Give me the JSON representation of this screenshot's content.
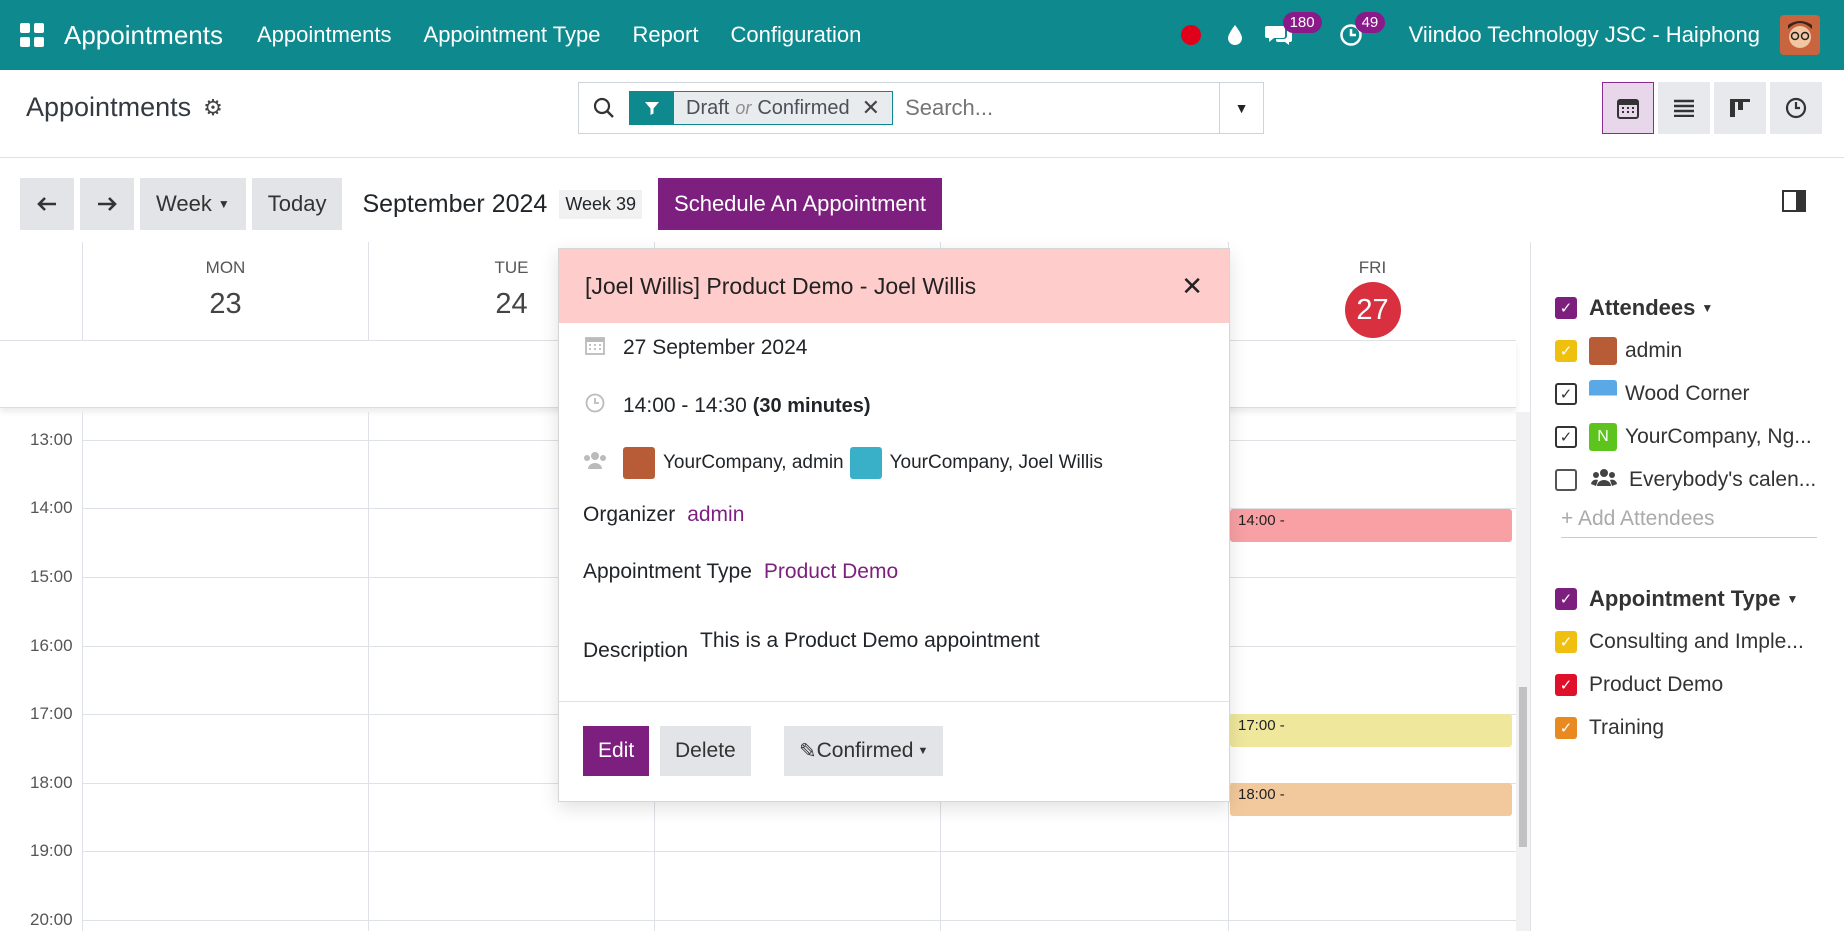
{
  "topbar": {
    "brand": "Appointments",
    "menu": [
      "Appointments",
      "Appointment Type",
      "Report",
      "Configuration"
    ],
    "chat_badge": "180",
    "activity_badge": "49",
    "company": "Viindoo Technology JSC - Haiphong"
  },
  "control_panel": {
    "title": "Appointments",
    "facet": {
      "value1": "Draft",
      "or": "or",
      "value2": "Confirmed"
    },
    "search_placeholder": "Search..."
  },
  "calendar_toolbar": {
    "scale": "Week",
    "today": "Today",
    "month": "September 2024",
    "week": "Week 39",
    "schedule": "Schedule An Appointment"
  },
  "days": [
    {
      "dow": "MON",
      "num": "23"
    },
    {
      "dow": "TUE",
      "num": "24"
    },
    {
      "dow": "FRI",
      "num": "27"
    }
  ],
  "hours": [
    "13:00",
    "14:00",
    "15:00",
    "16:00",
    "17:00",
    "18:00",
    "19:00",
    "20:00"
  ],
  "events": [
    {
      "time": "14:00 -",
      "color": "#f8a0a4"
    },
    {
      "time": "17:00 -",
      "color": "#efe89c"
    },
    {
      "time": "18:00 -",
      "color": "#f2c99c"
    }
  ],
  "sidebar": {
    "attendees_title": "Attendees",
    "attendees": [
      "admin",
      "Wood Corner",
      "YourCompany, Ng...",
      "Everybody's calen..."
    ],
    "add_attendees": "+ Add Attendees",
    "type_title": "Appointment Type",
    "types": [
      "Consulting and Imple...",
      "Product Demo",
      "Training"
    ],
    "colors": {
      "purple": "#7d1f7e",
      "yellow": "#f0c010",
      "red": "#e0102a",
      "orange": "#e88a20",
      "green": "#5cc41c"
    }
  },
  "popover": {
    "title": "[Joel Willis] Product Demo - Joel Willis",
    "date": "27 September 2024",
    "time": "14:00 - 14:30",
    "duration": "(30 minutes)",
    "attendee1": "YourCompany, admin",
    "attendee2": "YourCompany, Joel Willis",
    "organizer_label": "Organizer",
    "organizer": "admin",
    "type_label": "Appointment Type",
    "type": "Product Demo",
    "desc_label": "Description",
    "desc": "This is a Product Demo appointment",
    "edit": "Edit",
    "delete": "Delete",
    "status": "Confirmed"
  }
}
